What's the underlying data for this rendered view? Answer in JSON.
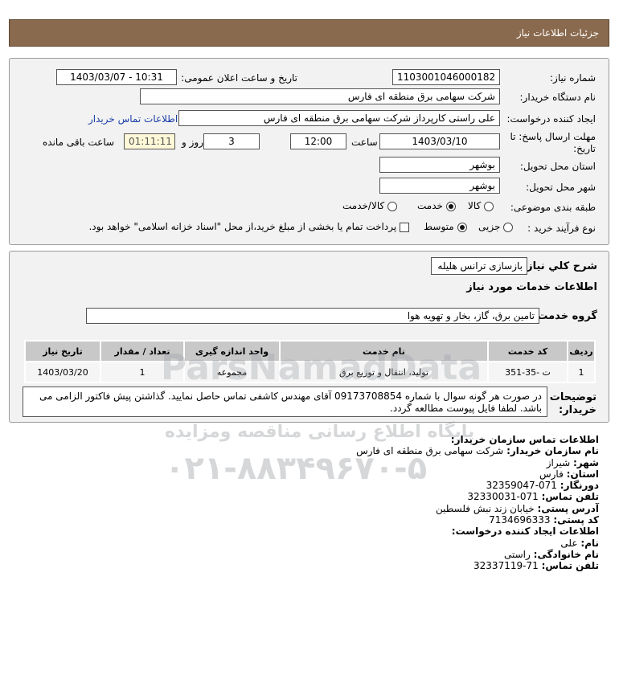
{
  "header": {
    "title": "جزئیات اطلاعات نیاز"
  },
  "need_number": {
    "label": "شماره نیاز:",
    "value": "1103001046000182"
  },
  "announce": {
    "label": "تاریخ و ساعت اعلان عمومی:",
    "value": "1403/03/07 - 10:31"
  },
  "buyer": {
    "label": "نام دستگاه خریدار:",
    "value": "شرکت سهامی برق منطقه ای فارس"
  },
  "creator": {
    "label": "ایجاد کننده درخواست:",
    "value": "علی راستی کارپرداز شرکت سهامی برق منطقه ای فارس",
    "contact_link": "اطلاعات تماس خریدار"
  },
  "deadline": {
    "label_line1": "مهلت ارسال پاسخ: تا",
    "label_line2": "تاریخ:",
    "date": "1403/03/10",
    "time_label": "ساعت",
    "time": "12:00",
    "days": "3",
    "days_label": "روز و",
    "remaining": "01:11:11",
    "remaining_label": "ساعت باقی مانده"
  },
  "province": {
    "label": "استان محل تحویل:",
    "value": "بوشهر"
  },
  "city": {
    "label": "شهر محل تحویل:",
    "value": "بوشهر"
  },
  "category": {
    "label": "طبقه بندی موضوعی:",
    "options": [
      "کالا",
      "خدمت",
      "کالا/خدمت"
    ],
    "selected": "خدمت"
  },
  "process": {
    "label": "نوع فرآیند خرید :",
    "options": [
      "جزیی",
      "متوسط"
    ],
    "selected": "متوسط",
    "payment_text": "پرداخت تمام یا بخشی از مبلغ خرید،از محل \"اسناد خزانه اسلامی\" خواهد بود."
  },
  "summary": {
    "label": "شرح کلي نیاز:",
    "value": "بازسازی ترانس هلیله"
  },
  "services_title": "اطلاعات خدمات مورد نیاز",
  "service_group": {
    "label": "گروه خدمت:",
    "value": "تامین برق، گاز، بخار و تهویه هوا"
  },
  "table": {
    "headers": [
      "ردیف",
      "کد خدمت",
      "نام خدمت",
      "واحد اندازه گیری",
      "تعداد / مقدار",
      "تاریخ نیاز"
    ],
    "rows": [
      [
        "1",
        "ت -35-351",
        "تولید، انتقال و توزیع برق",
        "مجموعه",
        "1",
        "1403/03/20"
      ]
    ]
  },
  "notes": {
    "label_line1": "توضیحات",
    "label_line2": "خریدار:",
    "text": "در صورت هر گونه سوال با شماره 09173708854 آقای مهندس کاشفی تماس حاصل نمایید. گذاشتن پیش فاکتور الزامی می باشد. لطفا فایل پیوست مطالعه گردد."
  },
  "org_contact": {
    "title": "اطلاعات تماس سازمان خریدار:",
    "org_label": "نام سازمان خریدار:",
    "org_value": "شرکت سهامی برق منطقه ای فارس",
    "city_label": "شهر:",
    "city_value": "شیراز",
    "province_label": "استان:",
    "province_value": "فارس",
    "fax_label": "دورنگار:",
    "fax_value": "071-32359047",
    "phone_label": "تلفن تماس:",
    "phone_value": "071-32330031",
    "address_label": "آدرس پستی:",
    "address_value": "خیابان زند نبش فلسطین",
    "postal_label": "کد پستی:",
    "postal_value": "7134696333"
  },
  "creator_contact": {
    "title": "اطلاعات ایجاد کننده درخواست:",
    "name_label": "نام:",
    "name_value": "علی",
    "family_label": "نام خانوادگی:",
    "family_value": "راستی",
    "phone_label": "تلفن تماس:",
    "phone_value": "71-32337119"
  },
  "watermark": {
    "brand": "ParsNamadData",
    "tagline": "پایگاه اطلاع رسانی مناقصه ومزایده",
    "phone": "۰۲۱-۸۸۳۴۹۶۷۰-۵"
  }
}
